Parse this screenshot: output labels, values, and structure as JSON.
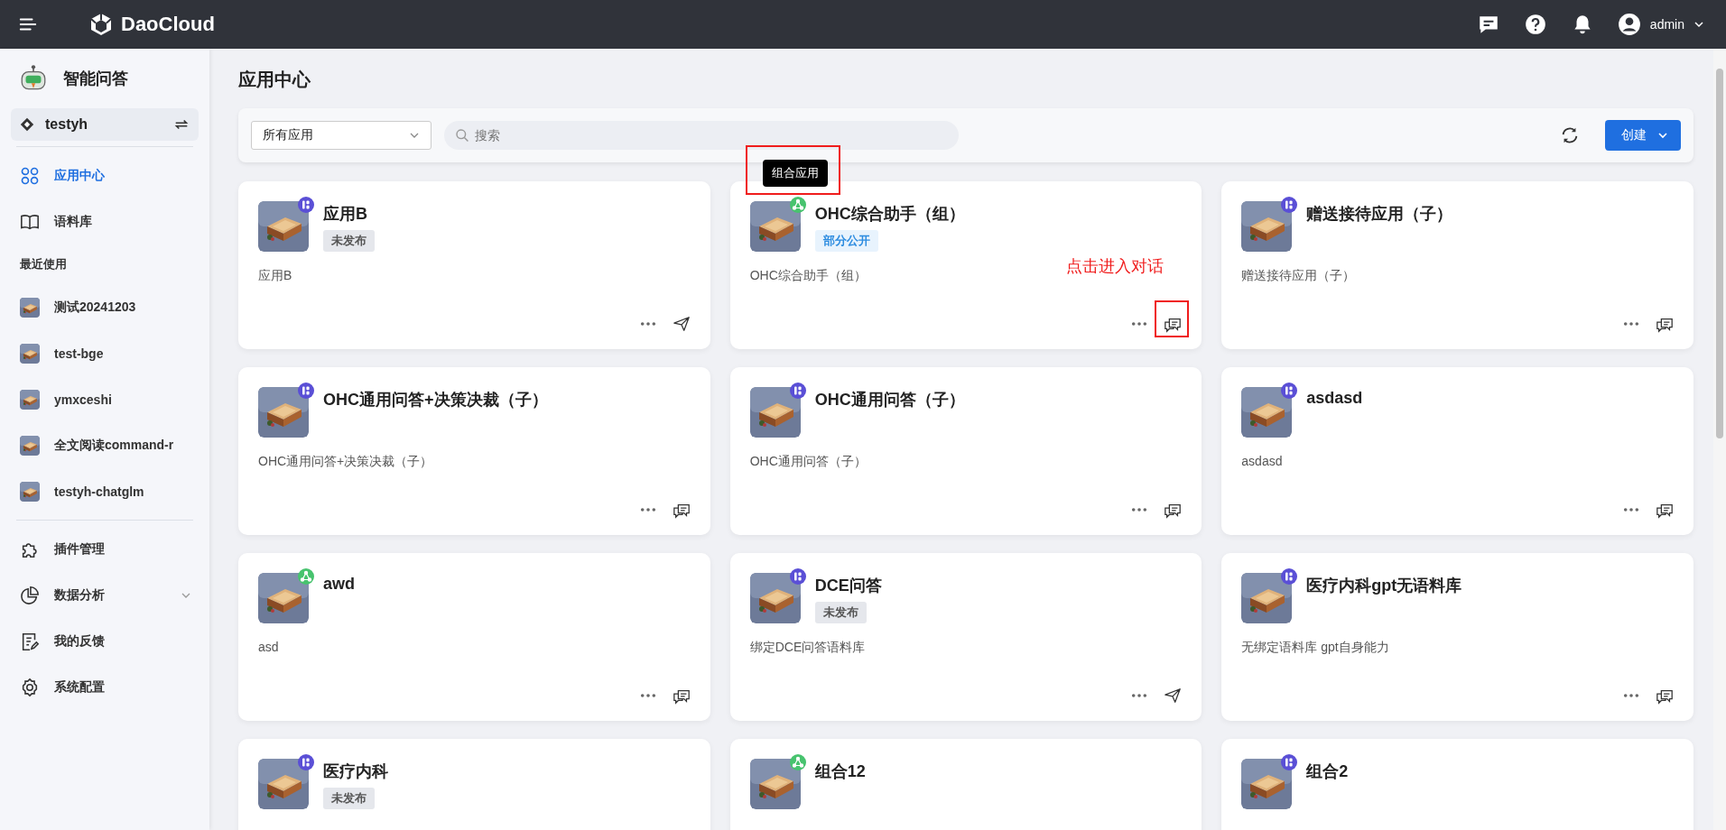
{
  "topbar": {
    "logo": "DaoCloud",
    "user": "admin"
  },
  "sidebar": {
    "title": "智能问答",
    "workspace": "testyh",
    "nav": [
      {
        "label": "应用中心",
        "selected": true
      },
      {
        "label": "语料库",
        "selected": false
      }
    ],
    "recent_heading": "最近使用",
    "recent": [
      {
        "label": "测试20241203"
      },
      {
        "label": "test-bge"
      },
      {
        "label": "ymxceshi"
      },
      {
        "label": "全文阅读command-r"
      },
      {
        "label": "testyh-chatglm"
      }
    ],
    "bottom": [
      {
        "label": "插件管理",
        "selected": false
      },
      {
        "label": "数据分析",
        "selected": false,
        "expandable": true
      },
      {
        "label": "我的反馈",
        "selected": false
      },
      {
        "label": "系统配置",
        "selected": false
      }
    ]
  },
  "page_title": "应用中心",
  "toolbar": {
    "filter": "所有应用",
    "search_placeholder": "搜索",
    "create": "创建"
  },
  "cards": [
    {
      "name": "应用B",
      "kind": "single",
      "tag": {
        "text": "未发布",
        "kind": "draft"
      },
      "description": "应用B",
      "action": {
        "kind": "send"
      }
    },
    {
      "name": "OHC综合助手（组）",
      "kind": "combo",
      "tag": {
        "text": "部分公开",
        "kind": "public"
      },
      "description": "OHC综合助手（组）",
      "action": {
        "kind": "chat"
      },
      "tooltip": "组合应用",
      "hint": "点击进入对话",
      "highlight_action": true
    },
    {
      "name": "赠送接待应用（子）",
      "kind": "single",
      "description": "赠送接待应用（子）",
      "action": {
        "kind": "chat"
      }
    },
    {
      "name": "OHC通用问答+决策决裁（子）",
      "kind": "single",
      "description": "OHC通用问答+决策决裁（子）",
      "action": {
        "kind": "chat"
      }
    },
    {
      "name": "OHC通用问答（子）",
      "kind": "single",
      "description": "OHC通用问答（子）",
      "action": {
        "kind": "chat"
      }
    },
    {
      "name": "asdasd",
      "kind": "single",
      "description": "asdasd",
      "action": {
        "kind": "chat"
      }
    },
    {
      "name": "awd",
      "kind": "combo",
      "description": "asd",
      "action": {
        "kind": "chat"
      }
    },
    {
      "name": "DCE问答",
      "kind": "single",
      "tag": {
        "text": "未发布",
        "kind": "draft"
      },
      "description": "绑定DCE问答语料库",
      "action": {
        "kind": "send"
      }
    },
    {
      "name": "医疗内科gpt无语料库",
      "kind": "single",
      "description": "无绑定语料库 gpt自身能力",
      "action": {
        "kind": "chat"
      }
    },
    {
      "name": "医疗内科",
      "kind": "single",
      "tag": {
        "text": "未发布",
        "kind": "draft"
      }
    },
    {
      "name": "组合12",
      "kind": "combo"
    },
    {
      "name": "组合2",
      "kind": "single"
    }
  ]
}
